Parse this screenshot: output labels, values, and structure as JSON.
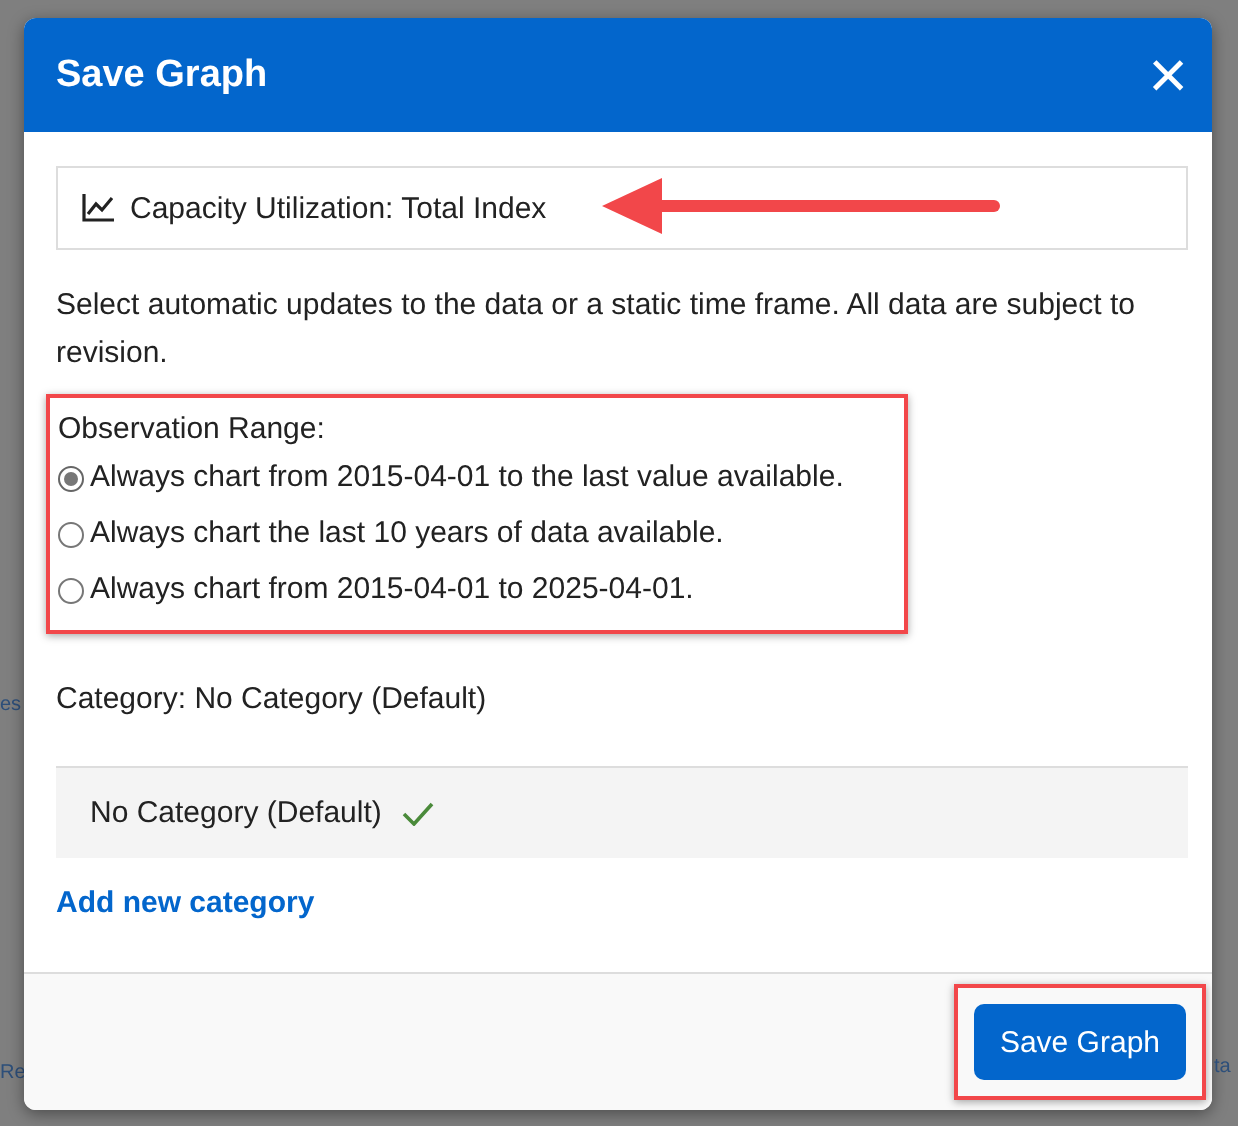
{
  "background": {
    "left_texts": [
      "es",
      "Re"
    ],
    "right_texts": [
      "ta"
    ]
  },
  "dialog": {
    "title": "Save Graph",
    "close": "×"
  },
  "series": {
    "title": "Capacity Utilization: Total Index",
    "highlighted": true
  },
  "description": "Select automatic updates to the data or a static time frame. All data are subject to revision.",
  "observation_range": {
    "label": "Observation Range:",
    "highlighted": true,
    "options": [
      {
        "label": "Always chart from 2015-04-01 to the last value available.",
        "selected": true
      },
      {
        "label": "Always chart the last 10 years of data available.",
        "selected": false
      },
      {
        "label": "Always chart from 2015-04-01 to 2025-04-01.",
        "selected": false
      }
    ]
  },
  "category": {
    "label": "Category: No Category (Default)",
    "items": [
      {
        "label": "No Category (Default)",
        "selected": true
      }
    ],
    "add_link": "Add new category"
  },
  "footer": {
    "button": "Save Graph",
    "highlighted": true
  }
}
